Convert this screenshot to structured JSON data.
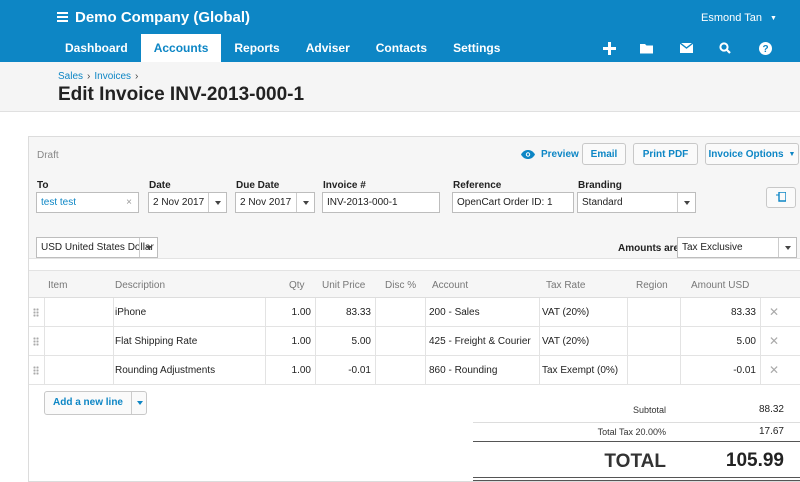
{
  "header": {
    "org_name": "Demo Company (Global)",
    "user_name": "Esmond Tan",
    "nav": [
      "Dashboard",
      "Accounts",
      "Reports",
      "Adviser",
      "Contacts",
      "Settings"
    ],
    "active_nav": "Accounts",
    "tools": [
      "plus-icon",
      "folder-icon",
      "mail-icon",
      "search-icon",
      "help-icon"
    ],
    "brand_color": "#0d86c5"
  },
  "breadcrumb": [
    "Sales",
    "Invoices"
  ],
  "page_title": "Edit Invoice INV-2013-000-1",
  "invoice": {
    "status": "Draft",
    "preview_label": "Preview",
    "email_label": "Email",
    "print_label": "Print PDF",
    "options_label": "Invoice Options",
    "fields": {
      "to_label": "To",
      "to_value": "test test",
      "date_label": "Date",
      "date_value": "2 Nov 2017",
      "due_label": "Due Date",
      "due_value": "2 Nov 2017",
      "number_label": "Invoice #",
      "number_value": "INV-2013-000-1",
      "reference_label": "Reference",
      "reference_value": "OpenCart Order ID: 1",
      "branding_label": "Branding",
      "branding_value": "Standard"
    },
    "currency": "USD United States Dollar",
    "amounts_are_label": "Amounts are",
    "amounts_are_value": "Tax Exclusive",
    "columns": [
      "Item",
      "Description",
      "Qty",
      "Unit Price",
      "Disc %",
      "Account",
      "Tax Rate",
      "Region",
      "Amount USD"
    ],
    "rows": [
      {
        "item": "",
        "description": "iPhone",
        "qty": "1.00",
        "unit_price": "83.33",
        "disc": "",
        "account": "200 - Sales",
        "tax_rate": "VAT (20%)",
        "region": "",
        "amount": "83.33"
      },
      {
        "item": "",
        "description": "Flat Shipping Rate",
        "qty": "1.00",
        "unit_price": "5.00",
        "disc": "",
        "account": "425 - Freight & Courier",
        "tax_rate": "VAT (20%)",
        "region": "",
        "amount": "5.00"
      },
      {
        "item": "",
        "description": "Rounding Adjustments",
        "qty": "1.00",
        "unit_price": "-0.01",
        "disc": "",
        "account": "860 - Rounding",
        "tax_rate": "Tax Exempt (0%)",
        "region": "",
        "amount": "-0.01"
      }
    ],
    "add_line_label": "Add a new line",
    "subtotal_label": "Subtotal",
    "subtotal_value": "88.32",
    "tax_label": "Total Tax 20.00%",
    "tax_value": "17.67",
    "total_label": "TOTAL",
    "total_value": "105.99"
  }
}
